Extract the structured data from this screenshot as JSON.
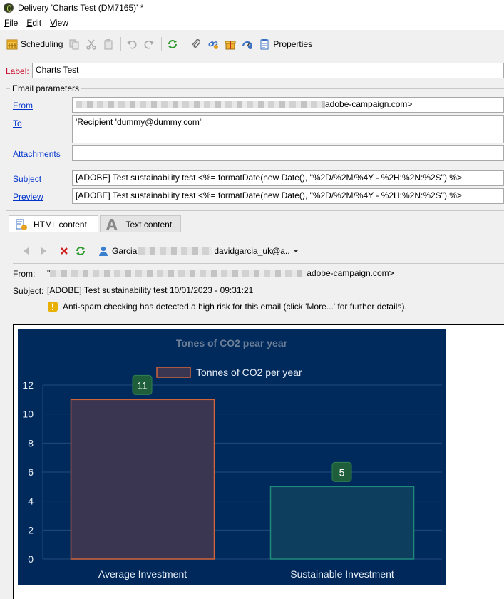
{
  "window": {
    "title": "Delivery 'Charts Test (DM7165)' *"
  },
  "menu": {
    "file": "File",
    "edit": "Edit",
    "view": "View"
  },
  "toolbar": {
    "scheduling": "Scheduling",
    "properties": "Properties"
  },
  "form": {
    "label_caption": "Label:",
    "label_value": "Charts Test",
    "group_title": "Email parameters",
    "from_link": "From",
    "from_value_suffix": "adobe-campaign.com>",
    "to_link": "To",
    "to_value": "'Recipient 'dummy@dummy.com''",
    "attachments_link": "Attachments",
    "subject_link": "Subject",
    "subject_value": "[ADOBE] Test sustainability test <%= formatDate(new Date(), \"%2D/%2M/%4Y - %2H:%2N:%2S\") %>",
    "preview_link": "Preview",
    "preview_value": "[ADOBE] Test sustainability test <%= formatDate(new Date(), \"%2D/%2M/%4Y - %2H:%2N:%2S\") %>"
  },
  "tabs": {
    "html": "HTML content",
    "text": "Text content"
  },
  "preview_bar": {
    "recipient_first": "Garcia",
    "recipient_email": "davidgarcia_uk@a.."
  },
  "preview": {
    "from_caption": "From:",
    "from_prefix": "\"",
    "from_suffix": "adobe-campaign.com>",
    "subject_caption": "Subject:",
    "subject_value": "[ADOBE] Test sustainability test 10/01/2023 - 09:31:21",
    "warning": "Anti-spam checking has detected a high risk for this email (click 'More...' for further details)."
  },
  "chart_data": {
    "type": "bar",
    "title": "Tones of CO2 pear year",
    "categories": [
      "Average Investment",
      "Sustainable Investment"
    ],
    "series": [
      {
        "name": "Tonnes of CO2 per year",
        "values": [
          11,
          5
        ]
      }
    ],
    "ylim": [
      0,
      12
    ],
    "yticks": [
      0,
      2,
      4,
      6,
      8,
      10,
      12
    ],
    "grid": true,
    "legend": "top",
    "colors": {
      "background": "#002a5c",
      "bar_fills": [
        "#3a3550",
        "#0e3e5e"
      ],
      "bar_strokes": [
        "#d2643a",
        "#1f8a7a"
      ],
      "label_badge": "#1e5e3a"
    }
  }
}
